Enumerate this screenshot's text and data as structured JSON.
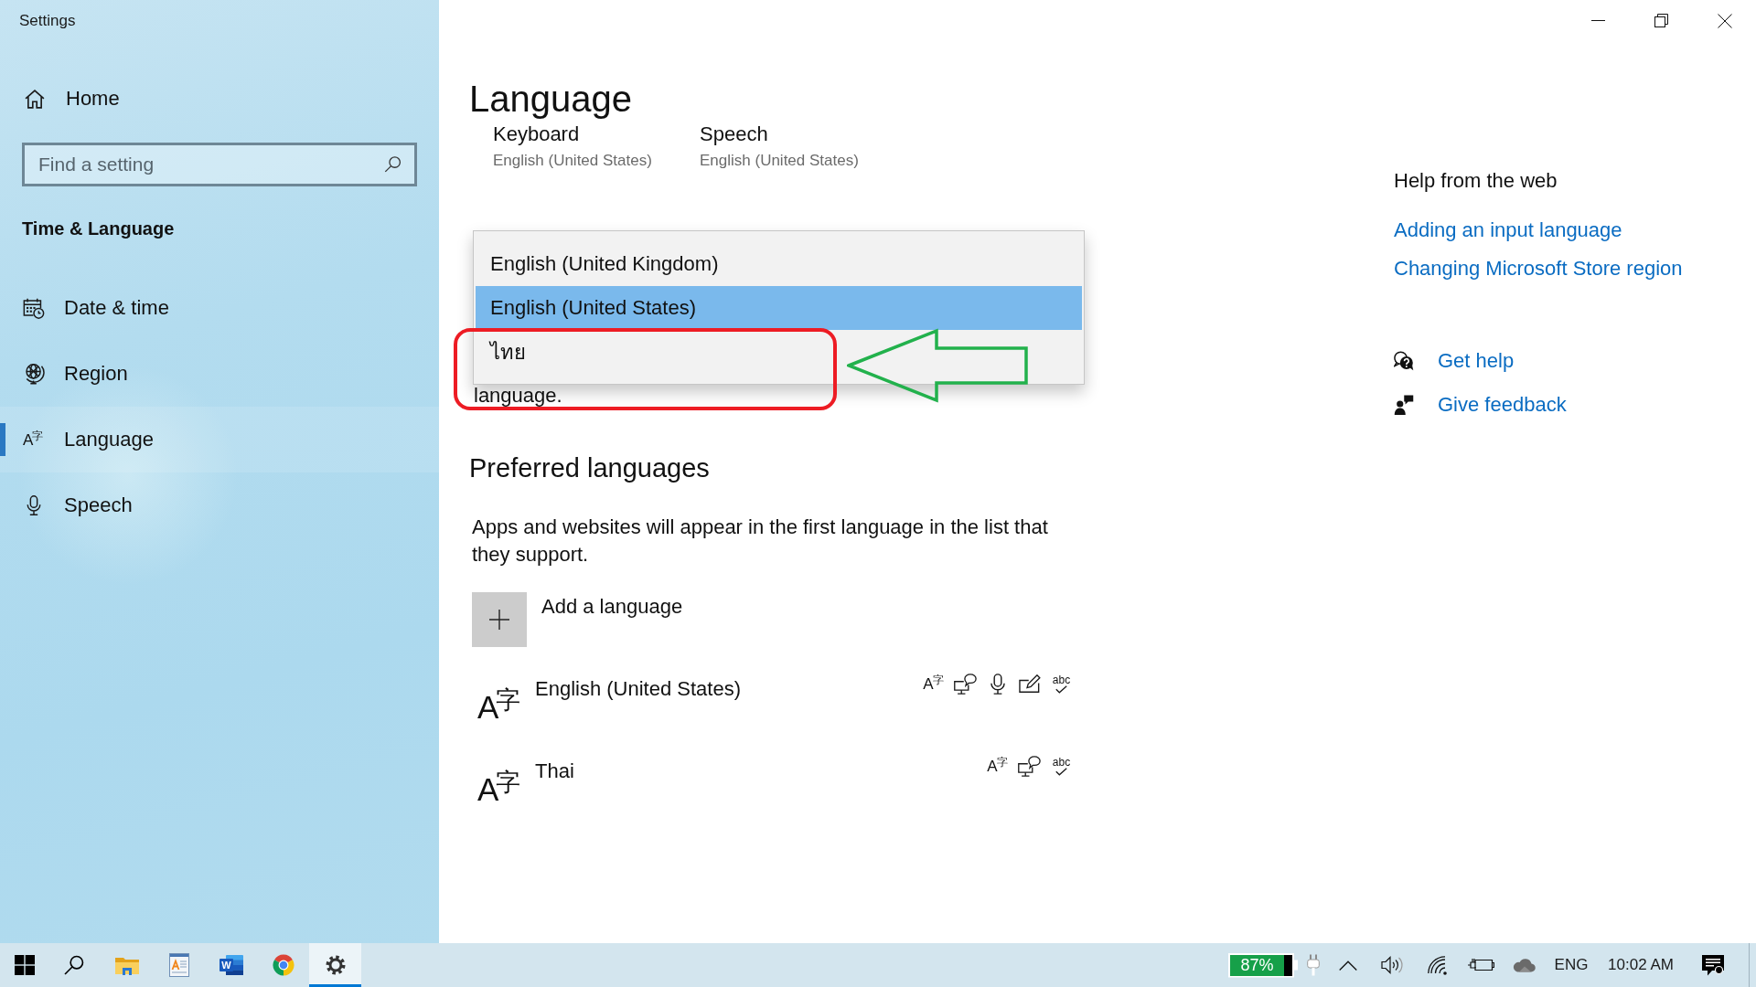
{
  "window": {
    "title": "Settings"
  },
  "sidebar": {
    "home": "Home",
    "search": {
      "placeholder": "Find a setting"
    },
    "section_title": "Time & Language",
    "items": [
      {
        "kind": "calendar",
        "label": "Date & time",
        "selected": false
      },
      {
        "kind": "globe",
        "label": "Region",
        "selected": false
      },
      {
        "kind": "language",
        "icon_text": "A$^{字}$",
        "label": "Language",
        "selected": true
      },
      {
        "kind": "microphone",
        "label": "Speech",
        "selected": false
      }
    ]
  },
  "page": {
    "title": "Language",
    "defaults": [
      {
        "label": "Keyboard",
        "value": "English (United States)"
      },
      {
        "label": "Speech",
        "value": "English (United States)"
      }
    ],
    "text_under_dropdown": "language.",
    "language_dropdown": {
      "options": [
        {
          "label": "English (United Kingdom)",
          "selected": false
        },
        {
          "label": "English (United States)",
          "selected": true
        },
        {
          "label": "ไทย",
          "selected": false
        }
      ]
    },
    "preferred_languages": {
      "title": "Preferred languages",
      "description": "Apps and websites will appear in the first language in the list that they support.",
      "add_button": "Add a language",
      "languages": [
        {
          "icon_text": "A$^{字}$",
          "name": "English (United States)",
          "selected": false,
          "features": [
            {
              "kind": "language",
              "icon_text": "A$^{字}$"
            },
            {
              "kind": "display"
            },
            {
              "kind": "microphone"
            },
            {
              "kind": "handwriting"
            },
            {
              "kind": "spelling",
              "label": "abc"
            }
          ]
        },
        {
          "icon_text": "A$^{字}$",
          "name": "Thai",
          "selected": false,
          "features": [
            {
              "kind": "language",
              "icon_text": "A$^{字}$"
            },
            {
              "kind": "display"
            },
            {
              "kind": "spelling",
              "label": "abc"
            }
          ]
        }
      ]
    }
  },
  "help": {
    "title": "Help from the web",
    "links": [
      "Adding an input language",
      "Changing Microsoft Store region"
    ],
    "actions": [
      {
        "kind": "help",
        "label": "Get help"
      },
      {
        "kind": "feedback",
        "label": "Give feedback"
      }
    ]
  },
  "annotations": [
    {
      "kind": "frame",
      "color": "#ed1c24"
    },
    {
      "kind": "arrow",
      "color": "#22b14c"
    }
  ],
  "taskbar": {
    "apps": [
      {
        "kind": "folder",
        "selected": false
      },
      {
        "kind": "document",
        "selected": false
      },
      {
        "kind": "word",
        "letter": "W",
        "selected": false
      },
      {
        "kind": "browser",
        "selected": false
      },
      {
        "kind": "settings",
        "selected": true
      }
    ],
    "battery": {
      "level": 0.87,
      "reading": "87%"
    },
    "input_language": "ENG",
    "time": "10:02 AM"
  }
}
